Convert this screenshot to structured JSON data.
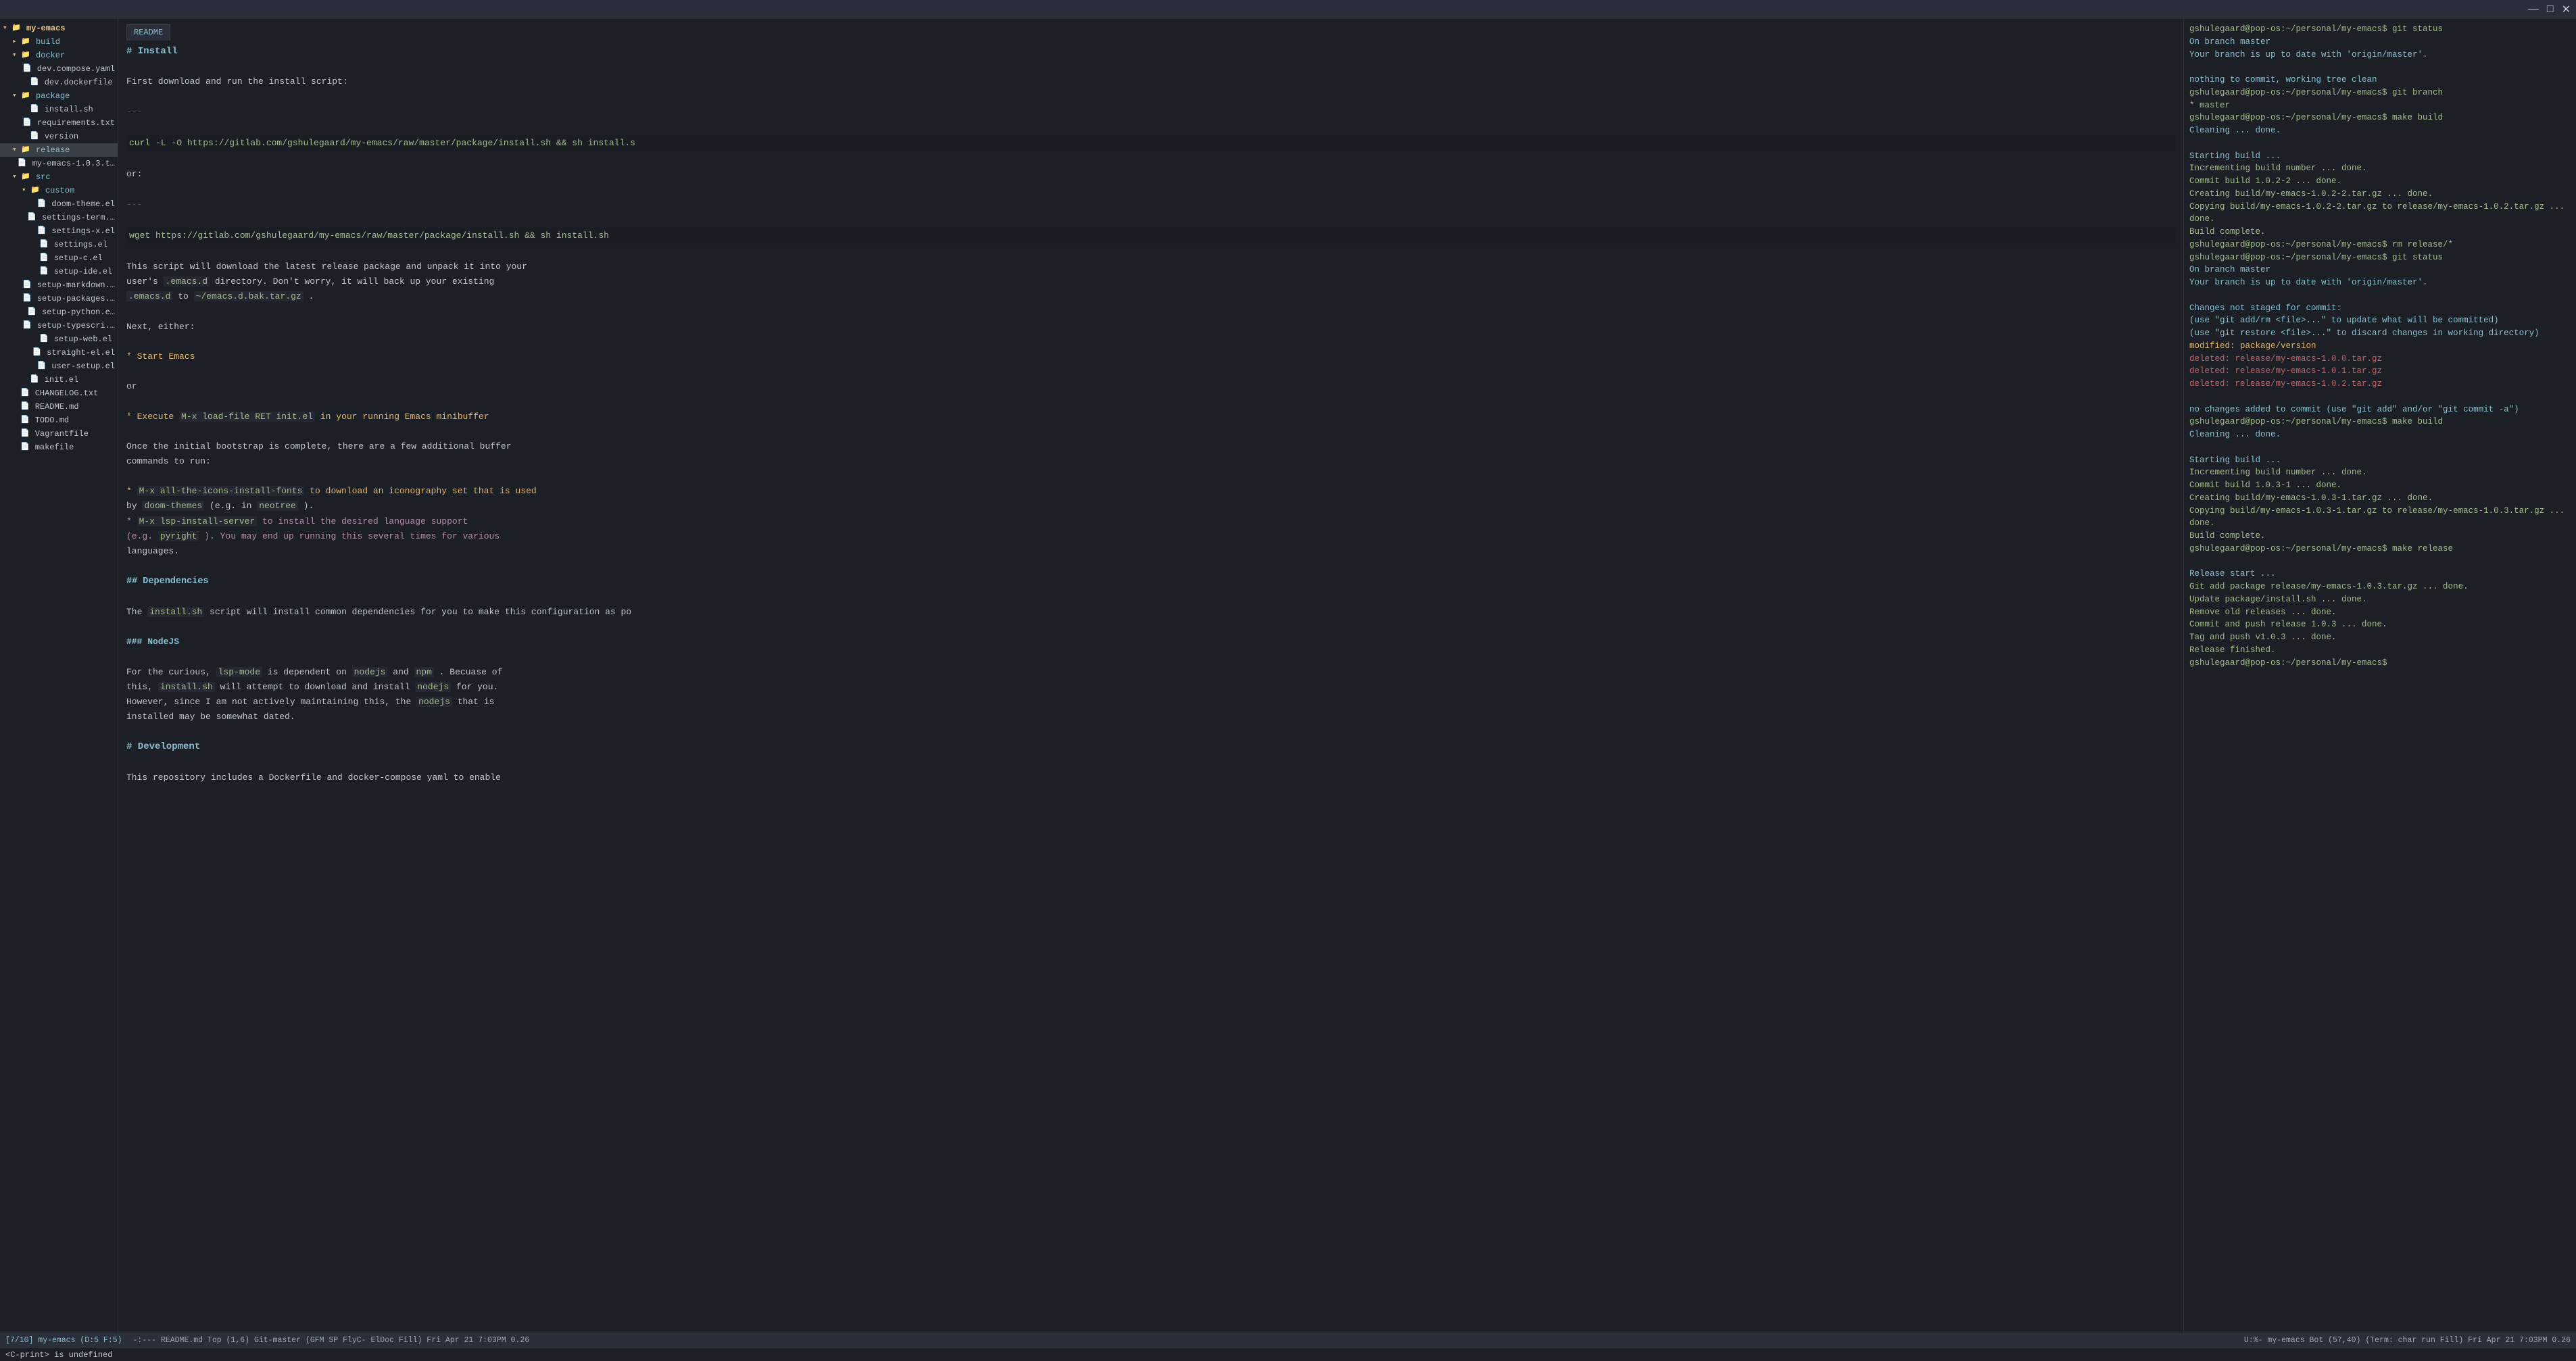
{
  "titlebar": {
    "minimize": "—",
    "maximize": "□",
    "close": "✕"
  },
  "sidebar": {
    "root": "my-emacs",
    "items": [
      {
        "id": "my-emacs",
        "label": "my-emacs",
        "type": "root-folder",
        "indent": 0,
        "expanded": true
      },
      {
        "id": "build",
        "label": "build",
        "type": "folder",
        "indent": 1,
        "expanded": false
      },
      {
        "id": "docker",
        "label": "docker",
        "type": "folder",
        "indent": 1,
        "expanded": true
      },
      {
        "id": "dev.compose.yaml",
        "label": "dev.compose.yaml",
        "type": "file",
        "indent": 2
      },
      {
        "id": "dev.dockerfile",
        "label": "dev.dockerfile",
        "type": "file",
        "indent": 2
      },
      {
        "id": "package",
        "label": "package",
        "type": "folder",
        "indent": 1,
        "expanded": true
      },
      {
        "id": "install.sh",
        "label": "install.sh",
        "type": "file",
        "indent": 2
      },
      {
        "id": "requirements.txt",
        "label": "requirements.txt",
        "type": "file",
        "indent": 2
      },
      {
        "id": "version",
        "label": "version",
        "type": "file",
        "indent": 2
      },
      {
        "id": "release",
        "label": "release",
        "type": "folder",
        "indent": 1,
        "expanded": true,
        "selected": true
      },
      {
        "id": "my-emacs-1.0.3.t",
        "label": "my-emacs-1.0.3.t…",
        "type": "file",
        "indent": 2
      },
      {
        "id": "src",
        "label": "src",
        "type": "folder",
        "indent": 1,
        "expanded": true
      },
      {
        "id": "custom",
        "label": "custom",
        "type": "folder",
        "indent": 2,
        "expanded": true
      },
      {
        "id": "doom-theme.el",
        "label": "doom-theme.el",
        "type": "file",
        "indent": 3
      },
      {
        "id": "settings-term",
        "label": "settings-term.…",
        "type": "file",
        "indent": 3
      },
      {
        "id": "settings-x.el",
        "label": "settings-x.el",
        "type": "file",
        "indent": 3
      },
      {
        "id": "settings.el",
        "label": "settings.el",
        "type": "file",
        "indent": 3
      },
      {
        "id": "setup-c.el",
        "label": "setup-c.el",
        "type": "file",
        "indent": 3
      },
      {
        "id": "setup-ide.el",
        "label": "setup-ide.el",
        "type": "file",
        "indent": 3
      },
      {
        "id": "setup-markdown",
        "label": "setup-markdown.…",
        "type": "file",
        "indent": 3
      },
      {
        "id": "setup-packages",
        "label": "setup-packages.…",
        "type": "file",
        "indent": 3
      },
      {
        "id": "setup-python.e",
        "label": "setup-python.e…",
        "type": "file",
        "indent": 3
      },
      {
        "id": "setup-typescri",
        "label": "setup-typescri.…",
        "type": "file",
        "indent": 3
      },
      {
        "id": "setup-web.el",
        "label": "setup-web.el",
        "type": "file",
        "indent": 3
      },
      {
        "id": "straight-el.el",
        "label": "straight-el.el",
        "type": "file",
        "indent": 3
      },
      {
        "id": "user-setup.el",
        "label": "user-setup.el",
        "type": "file",
        "indent": 3
      },
      {
        "id": "init.el",
        "label": "init.el",
        "type": "file",
        "indent": 2
      },
      {
        "id": "CHANGELOG.txt",
        "label": "CHANGELOG.txt",
        "type": "file",
        "indent": 1
      },
      {
        "id": "README.md",
        "label": "README.md",
        "type": "file",
        "indent": 1
      },
      {
        "id": "TODO.md",
        "label": "TODO.md",
        "type": "file",
        "indent": 1
      },
      {
        "id": "Vagrantfile",
        "label": "Vagrantfile",
        "type": "file",
        "indent": 1
      },
      {
        "id": "makefile",
        "label": "makefile",
        "type": "file",
        "indent": 1
      }
    ]
  },
  "editor": {
    "tab": "README",
    "lines": [
      {
        "type": "h1",
        "text": "# Install"
      },
      {
        "type": "blank"
      },
      {
        "type": "normal",
        "text": "First download and run the install script:"
      },
      {
        "type": "blank"
      },
      {
        "type": "ellipsis",
        "text": "---"
      },
      {
        "type": "blank"
      },
      {
        "type": "code",
        "text": "curl -L -O https://gitlab.com/gshulegaard/my-emacs/raw/master/package/install.sh  && sh install.s"
      },
      {
        "type": "blank"
      },
      {
        "type": "normal",
        "text": "or:"
      },
      {
        "type": "blank"
      },
      {
        "type": "ellipsis",
        "text": "---"
      },
      {
        "type": "blank"
      },
      {
        "type": "code",
        "text": "wget https://gitlab.com/gshulegaard/my-emacs/raw/master/package/install.sh && sh install.sh"
      },
      {
        "type": "blank"
      },
      {
        "type": "normal",
        "text": "This script will download the latest release package and unpack it into your"
      },
      {
        "type": "normal",
        "text": "user's  `.emacs.d`  directory.  Don't worry, it will back up your existing"
      },
      {
        "type": "normal",
        "text": " `.emacs.d`  to  `~/emacs.d.bak.tar.gz` ."
      },
      {
        "type": "blank"
      },
      {
        "type": "normal",
        "text": "Next, either:"
      },
      {
        "type": "blank"
      },
      {
        "type": "bullet",
        "text": "* Start Emacs"
      },
      {
        "type": "blank"
      },
      {
        "type": "normal",
        "text": "or"
      },
      {
        "type": "blank"
      },
      {
        "type": "bullet",
        "text": "* Execute  `M-x load-file RET init.el`  in your running Emacs minibuffer"
      },
      {
        "type": "blank"
      },
      {
        "type": "normal",
        "text": "Once the initial bootstrap is complete, there are a few additional buffer"
      },
      {
        "type": "normal",
        "text": "commands to run:"
      },
      {
        "type": "blank"
      },
      {
        "type": "bullet",
        "text": "*  `M-x all-the-icons-install-fonts`  to download an iconography set that is used"
      },
      {
        "type": "normal",
        "text": "   by  `doom-themes`  (e.g. in  `neotree` )."
      },
      {
        "type": "bullet-emphasis",
        "text": "*  `M-x lsp-install-server`  to install the desired language support"
      },
      {
        "type": "normal-emphasis",
        "text": "  (e.g.  `pyright` ).  You may end up running this several times for various"
      },
      {
        "type": "normal",
        "text": "  languages."
      },
      {
        "type": "blank"
      },
      {
        "type": "h2",
        "text": "## Dependencies"
      },
      {
        "type": "blank"
      },
      {
        "type": "normal",
        "text": "The  `install.sh`  script will install common dependencies for you to make this configuration as po"
      },
      {
        "type": "blank"
      },
      {
        "type": "h3",
        "text": "### NodeJS"
      },
      {
        "type": "blank"
      },
      {
        "type": "normal",
        "text": "For the curious,  `lsp-mode`  is dependent on  `nodejs`  and  `npm` .  Becuase of"
      },
      {
        "type": "normal",
        "text": "this,  `install.sh`  will attempt to download and install  `nodejs`  for you."
      },
      {
        "type": "normal",
        "text": "However, since I am not actively maintaining this, the  `nodejs`  that is"
      },
      {
        "type": "normal",
        "text": "installed may be somewhat dated."
      },
      {
        "type": "blank"
      },
      {
        "type": "h1",
        "text": "# Development"
      },
      {
        "type": "blank"
      },
      {
        "type": "normal",
        "text": "This repository includes a Dockerfile and docker-compose yaml to enable"
      }
    ]
  },
  "terminal": {
    "lines": [
      {
        "cls": "term-prompt",
        "text": "gshulegaard@pop-os:~/personal/my-emacs$ git status"
      },
      {
        "cls": "term-info",
        "text": "On branch master"
      },
      {
        "cls": "term-info",
        "text": "Your branch is up to date with 'origin/master'."
      },
      {
        "cls": "",
        "text": ""
      },
      {
        "cls": "term-info",
        "text": "nothing to commit, working tree clean"
      },
      {
        "cls": "term-prompt",
        "text": "gshulegaard@pop-os:~/personal/my-emacs$ git branch"
      },
      {
        "cls": "term-branch",
        "text": "* master"
      },
      {
        "cls": "term-prompt",
        "text": "gshulegaard@pop-os:~/personal/my-emacs$ make build"
      },
      {
        "cls": "term-info",
        "text": "  Cleaning ... done."
      },
      {
        "cls": "",
        "text": ""
      },
      {
        "cls": "term-info",
        "text": "Starting build ..."
      },
      {
        "cls": "term-ok",
        "text": "  Incrementing build number ... done."
      },
      {
        "cls": "term-ok",
        "text": "  Commit build 1.0.2-2 ... done."
      },
      {
        "cls": "term-ok",
        "text": "  Creating build/my-emacs-1.0.2-2.tar.gz ... done."
      },
      {
        "cls": "term-ok",
        "text": "  Copying build/my-emacs-1.0.2-2.tar.gz to release/my-emacs-1.0.2.tar.gz ... done."
      },
      {
        "cls": "term-ok",
        "text": "Build complete."
      },
      {
        "cls": "term-prompt",
        "text": "gshulegaard@pop-os:~/personal/my-emacs$ rm release/*"
      },
      {
        "cls": "term-prompt",
        "text": "gshulegaard@pop-os:~/personal/my-emacs$ git status"
      },
      {
        "cls": "term-info",
        "text": "On branch master"
      },
      {
        "cls": "term-info",
        "text": "Your branch is up to date with 'origin/master'."
      },
      {
        "cls": "",
        "text": ""
      },
      {
        "cls": "term-info",
        "text": "Changes not staged for commit:"
      },
      {
        "cls": "term-info",
        "text": "  (use \"git add/rm <file>...\" to update what will be committed)"
      },
      {
        "cls": "term-info",
        "text": "  (use \"git restore <file>...\" to discard changes in working directory)"
      },
      {
        "cls": "term-mod",
        "text": "        modified:   package/version"
      },
      {
        "cls": "term-del",
        "text": "        deleted:    release/my-emacs-1.0.0.tar.gz"
      },
      {
        "cls": "term-del",
        "text": "        deleted:    release/my-emacs-1.0.1.tar.gz"
      },
      {
        "cls": "term-del",
        "text": "        deleted:    release/my-emacs-1.0.2.tar.gz"
      },
      {
        "cls": "",
        "text": ""
      },
      {
        "cls": "term-info",
        "text": "no changes added to commit (use \"git add\" and/or \"git commit -a\")"
      },
      {
        "cls": "term-prompt",
        "text": "gshulegaard@pop-os:~/personal/my-emacs$ make build"
      },
      {
        "cls": "term-info",
        "text": "  Cleaning ... done."
      },
      {
        "cls": "",
        "text": ""
      },
      {
        "cls": "term-info",
        "text": "Starting build ..."
      },
      {
        "cls": "term-ok",
        "text": "  Incrementing build number ... done."
      },
      {
        "cls": "term-ok",
        "text": "  Commit build 1.0.3-1 ... done."
      },
      {
        "cls": "term-ok",
        "text": "  Creating build/my-emacs-1.0.3-1.tar.gz ... done."
      },
      {
        "cls": "term-ok",
        "text": "  Copying build/my-emacs-1.0.3-1.tar.gz to release/my-emacs-1.0.3.tar.gz ... done."
      },
      {
        "cls": "term-ok",
        "text": "Build complete."
      },
      {
        "cls": "term-prompt",
        "text": "gshulegaard@pop-os:~/personal/my-emacs$ make release"
      },
      {
        "cls": "",
        "text": ""
      },
      {
        "cls": "term-info",
        "text": "Release start ..."
      },
      {
        "cls": "term-ok",
        "text": "  Git add package release/my-emacs-1.0.3.tar.gz ... done."
      },
      {
        "cls": "term-ok",
        "text": "  Update package/install.sh ... done."
      },
      {
        "cls": "term-ok",
        "text": "  Remove old releases ... done."
      },
      {
        "cls": "term-ok",
        "text": "  Commit and push release 1.0.3 ... done."
      },
      {
        "cls": "term-ok",
        "text": "  Tag and push v1.0.3 ... done."
      },
      {
        "cls": "term-ok",
        "text": "  Release finished."
      },
      {
        "cls": "term-prompt",
        "text": "gshulegaard@pop-os:~/personal/my-emacs$ "
      }
    ]
  },
  "statusbar": {
    "left": "[7/10]  my-emacs  (D:5 F:5)",
    "mode_line": "-:---  README.md    Top (1,6)    Git-master  (GFM SP FlyC- ElDoc Fill)  Fri Apr 21 7:03PM 0.26",
    "right": "U:%-    my-emacs      Bot (57,40)     (Term: char run Fill)  Fri Apr 21 7:03PM 0.26"
  },
  "minibuffer": {
    "text": "<C-print> is undefined"
  }
}
